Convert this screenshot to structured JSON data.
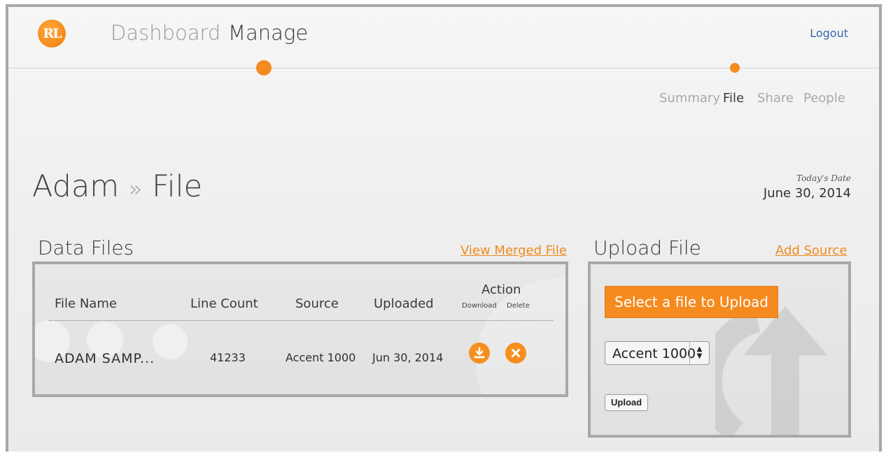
{
  "header": {
    "logo_text": "RL",
    "nav": [
      "Dashboard",
      "Manage"
    ],
    "logout": "Logout"
  },
  "subnav": [
    "Summary",
    "File",
    "Share",
    "People"
  ],
  "page": {
    "breadcrumb_user": "Adam",
    "breadcrumb_sep": "»",
    "breadcrumb_page": "File",
    "date_label": "Today's Date",
    "date_value": "June 30, 2014"
  },
  "data_files": {
    "title": "Data Files",
    "view_merged": "View Merged File",
    "columns": [
      "File Name",
      "Line Count",
      "Source",
      "Uploaded",
      "Action"
    ],
    "action_sub": [
      "Download",
      "Delete"
    ],
    "rows": [
      {
        "file_name": "ADAM SAMP...",
        "line_count": "41233",
        "source": "Accent 1000",
        "uploaded": "Jun 30, 2014"
      }
    ]
  },
  "upload": {
    "title": "Upload File",
    "add_source": "Add Source",
    "select_button": "Select a file to Upload",
    "source_value": "Accent 1000",
    "upload_button": "Upload"
  },
  "colors": {
    "accent": "#f58a1f",
    "link": "#3868a8"
  }
}
